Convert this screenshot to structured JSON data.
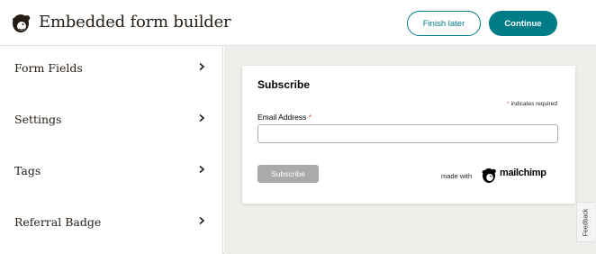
{
  "header": {
    "title": "Embedded form builder",
    "finish_later_label": "Finish later",
    "continue_label": "Continue"
  },
  "sidebar": {
    "items": [
      {
        "label": "Form Fields"
      },
      {
        "label": "Settings"
      },
      {
        "label": "Tags"
      },
      {
        "label": "Referral Badge"
      }
    ]
  },
  "form": {
    "title": "Subscribe",
    "required_asterisk": "*",
    "required_note": "indicates required",
    "email_label": "Email Address",
    "email_value": "",
    "subscribe_label": "Subscribe",
    "made_with": "made with",
    "brand": "mailchimp"
  },
  "feedback_label": "Feedback",
  "colors": {
    "accent": "#007c89",
    "canvas": "#efeeea",
    "required": "#e85c41",
    "disabled_button": "#aaaaaa"
  },
  "icons": {
    "logo": "mailchimp-freddie-icon",
    "chevron": "chevron-right-icon"
  }
}
